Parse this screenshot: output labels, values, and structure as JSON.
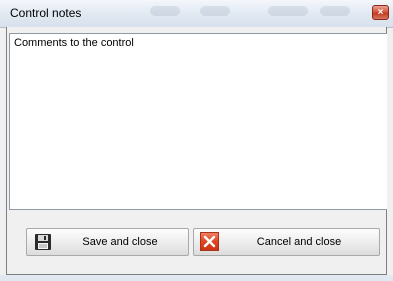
{
  "window": {
    "title": "Control notes",
    "close_glyph": "×"
  },
  "notes": {
    "value": "Comments to the control"
  },
  "buttons": {
    "save_label": "Save and close",
    "save_icon": "floppy-disk-icon",
    "cancel_label": "Cancel and close",
    "cancel_icon": "red-x-icon"
  },
  "colors": {
    "close_red": "#c23a1e",
    "cancel_icon_red": "#e0451f"
  }
}
